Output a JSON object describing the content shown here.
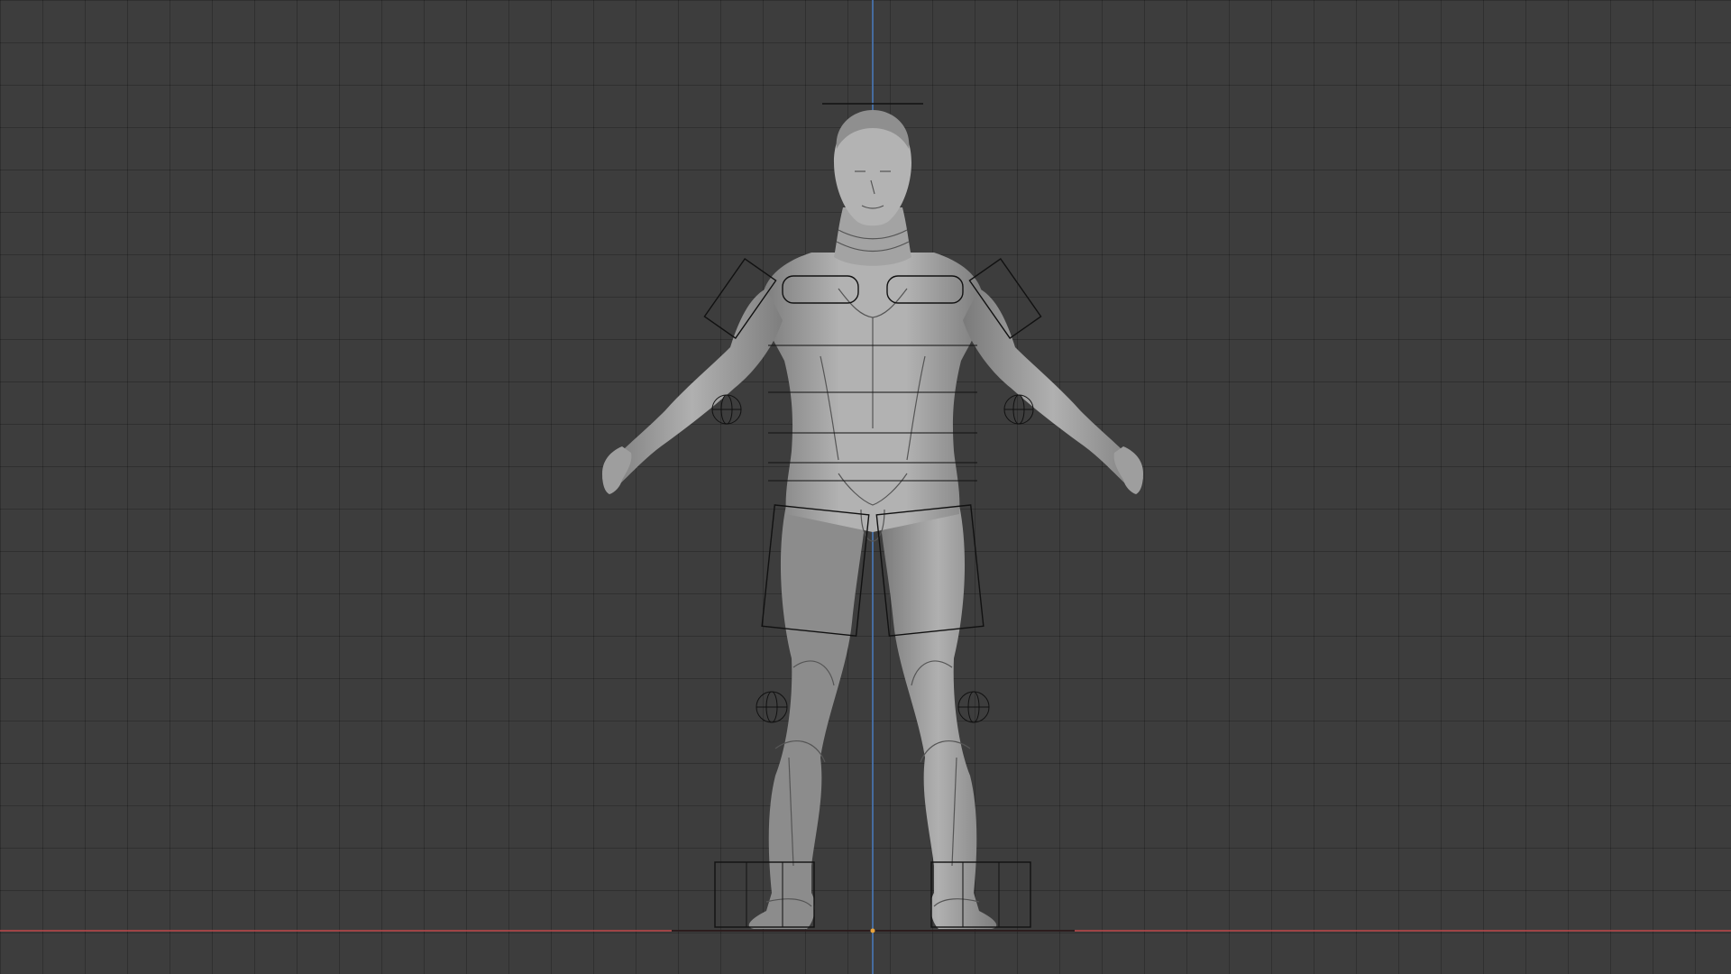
{
  "viewport": {
    "background_color": "#3d3d3d",
    "grid_color": "#353535",
    "x_axis_color": "#c0474a",
    "z_axis_color": "#4a7cc0",
    "origin_color": "#e8a33c",
    "mesh_color": "#9a9a9a",
    "rig_color": "#111111"
  }
}
